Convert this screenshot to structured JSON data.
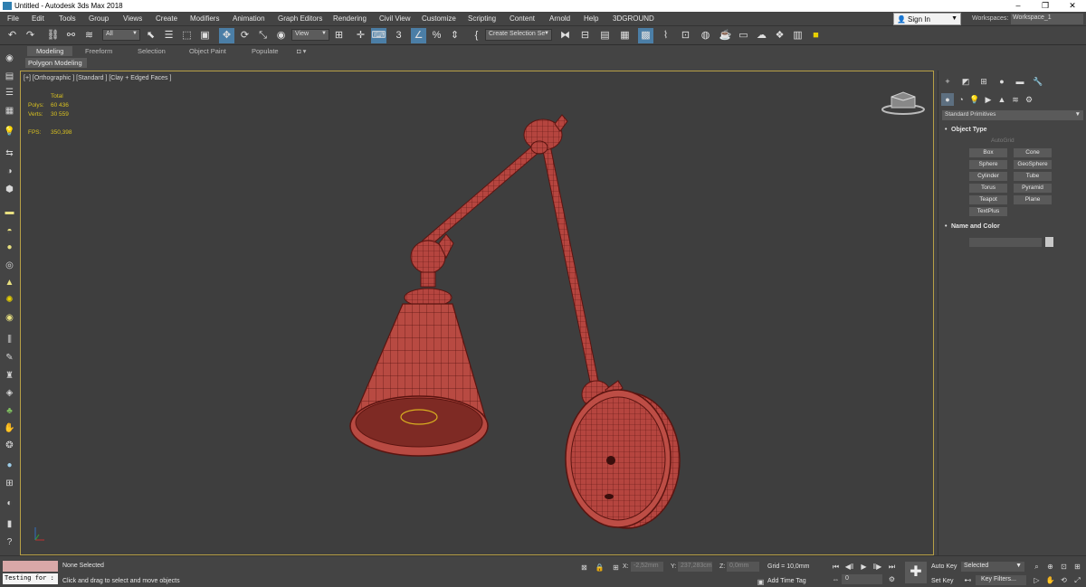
{
  "window": {
    "title": "Untitled - Autodesk 3ds Max 2018",
    "minimize_glyph": "–",
    "maximize_glyph": "❐",
    "close_glyph": "✕"
  },
  "menu": [
    "File",
    "Edit",
    "Tools",
    "Group",
    "Views",
    "Create",
    "Modifiers",
    "Animation",
    "Graph Editors",
    "Rendering",
    "Civil View",
    "Customize",
    "Scripting",
    "Content",
    "Arnold",
    "Help",
    "3DGROUND"
  ],
  "account": {
    "sign_in": "Sign In",
    "workspaces_label": "Workspaces:",
    "workspace_value": "Workspace_1"
  },
  "toolbar": {
    "selection_filter": "All",
    "reference_coord": "View",
    "create_selection_set": "Create Selection Se"
  },
  "ribbon": {
    "tabs": [
      "Modeling",
      "Freeform",
      "Selection",
      "Object Paint",
      "Populate"
    ],
    "active_tab": "Modeling",
    "panel_label": "Polygon Modeling"
  },
  "viewport": {
    "label": "[+] [Orthographic ] [Standard ] [Clay + Edged Faces ]",
    "stats": {
      "total_label": "Total",
      "polys_label": "Polys:",
      "polys_value": "60 436",
      "verts_label": "Verts:",
      "verts_value": "30 559",
      "fps_label": "FPS:",
      "fps_value": "350,398"
    },
    "model_color": "#b5453f",
    "wire_color": "#5a1410"
  },
  "command_panel": {
    "category": "Standard Primitives",
    "object_type_title": "Object Type",
    "autogrid": "AutoGrid",
    "object_buttons": [
      "Box",
      "Cone",
      "Sphere",
      "GeoSphere",
      "Cylinder",
      "Tube",
      "Torus",
      "Pyramid",
      "Teapot",
      "Plane",
      "TextPlus"
    ],
    "name_color_title": "Name and Color"
  },
  "status": {
    "testing": "Testing for :",
    "selection": "None Selected",
    "prompt": "Click and drag to select and move objects",
    "x_label": "X:",
    "x_value": "-2,52mm",
    "y_label": "Y:",
    "y_value": "237,283cm",
    "z_label": "Z:",
    "z_value": "0,0mm",
    "grid": "Grid = 10,0mm",
    "add_time_tag": "Add Time Tag",
    "frame": "0",
    "auto_key": "Auto Key",
    "set_key": "Set Key",
    "selected": "Selected",
    "key_filters": "Key Filters..."
  },
  "colors": {
    "accent": "#4b7ea6",
    "viewport_border": "#b7a046",
    "stats_text": "#d8c020"
  }
}
